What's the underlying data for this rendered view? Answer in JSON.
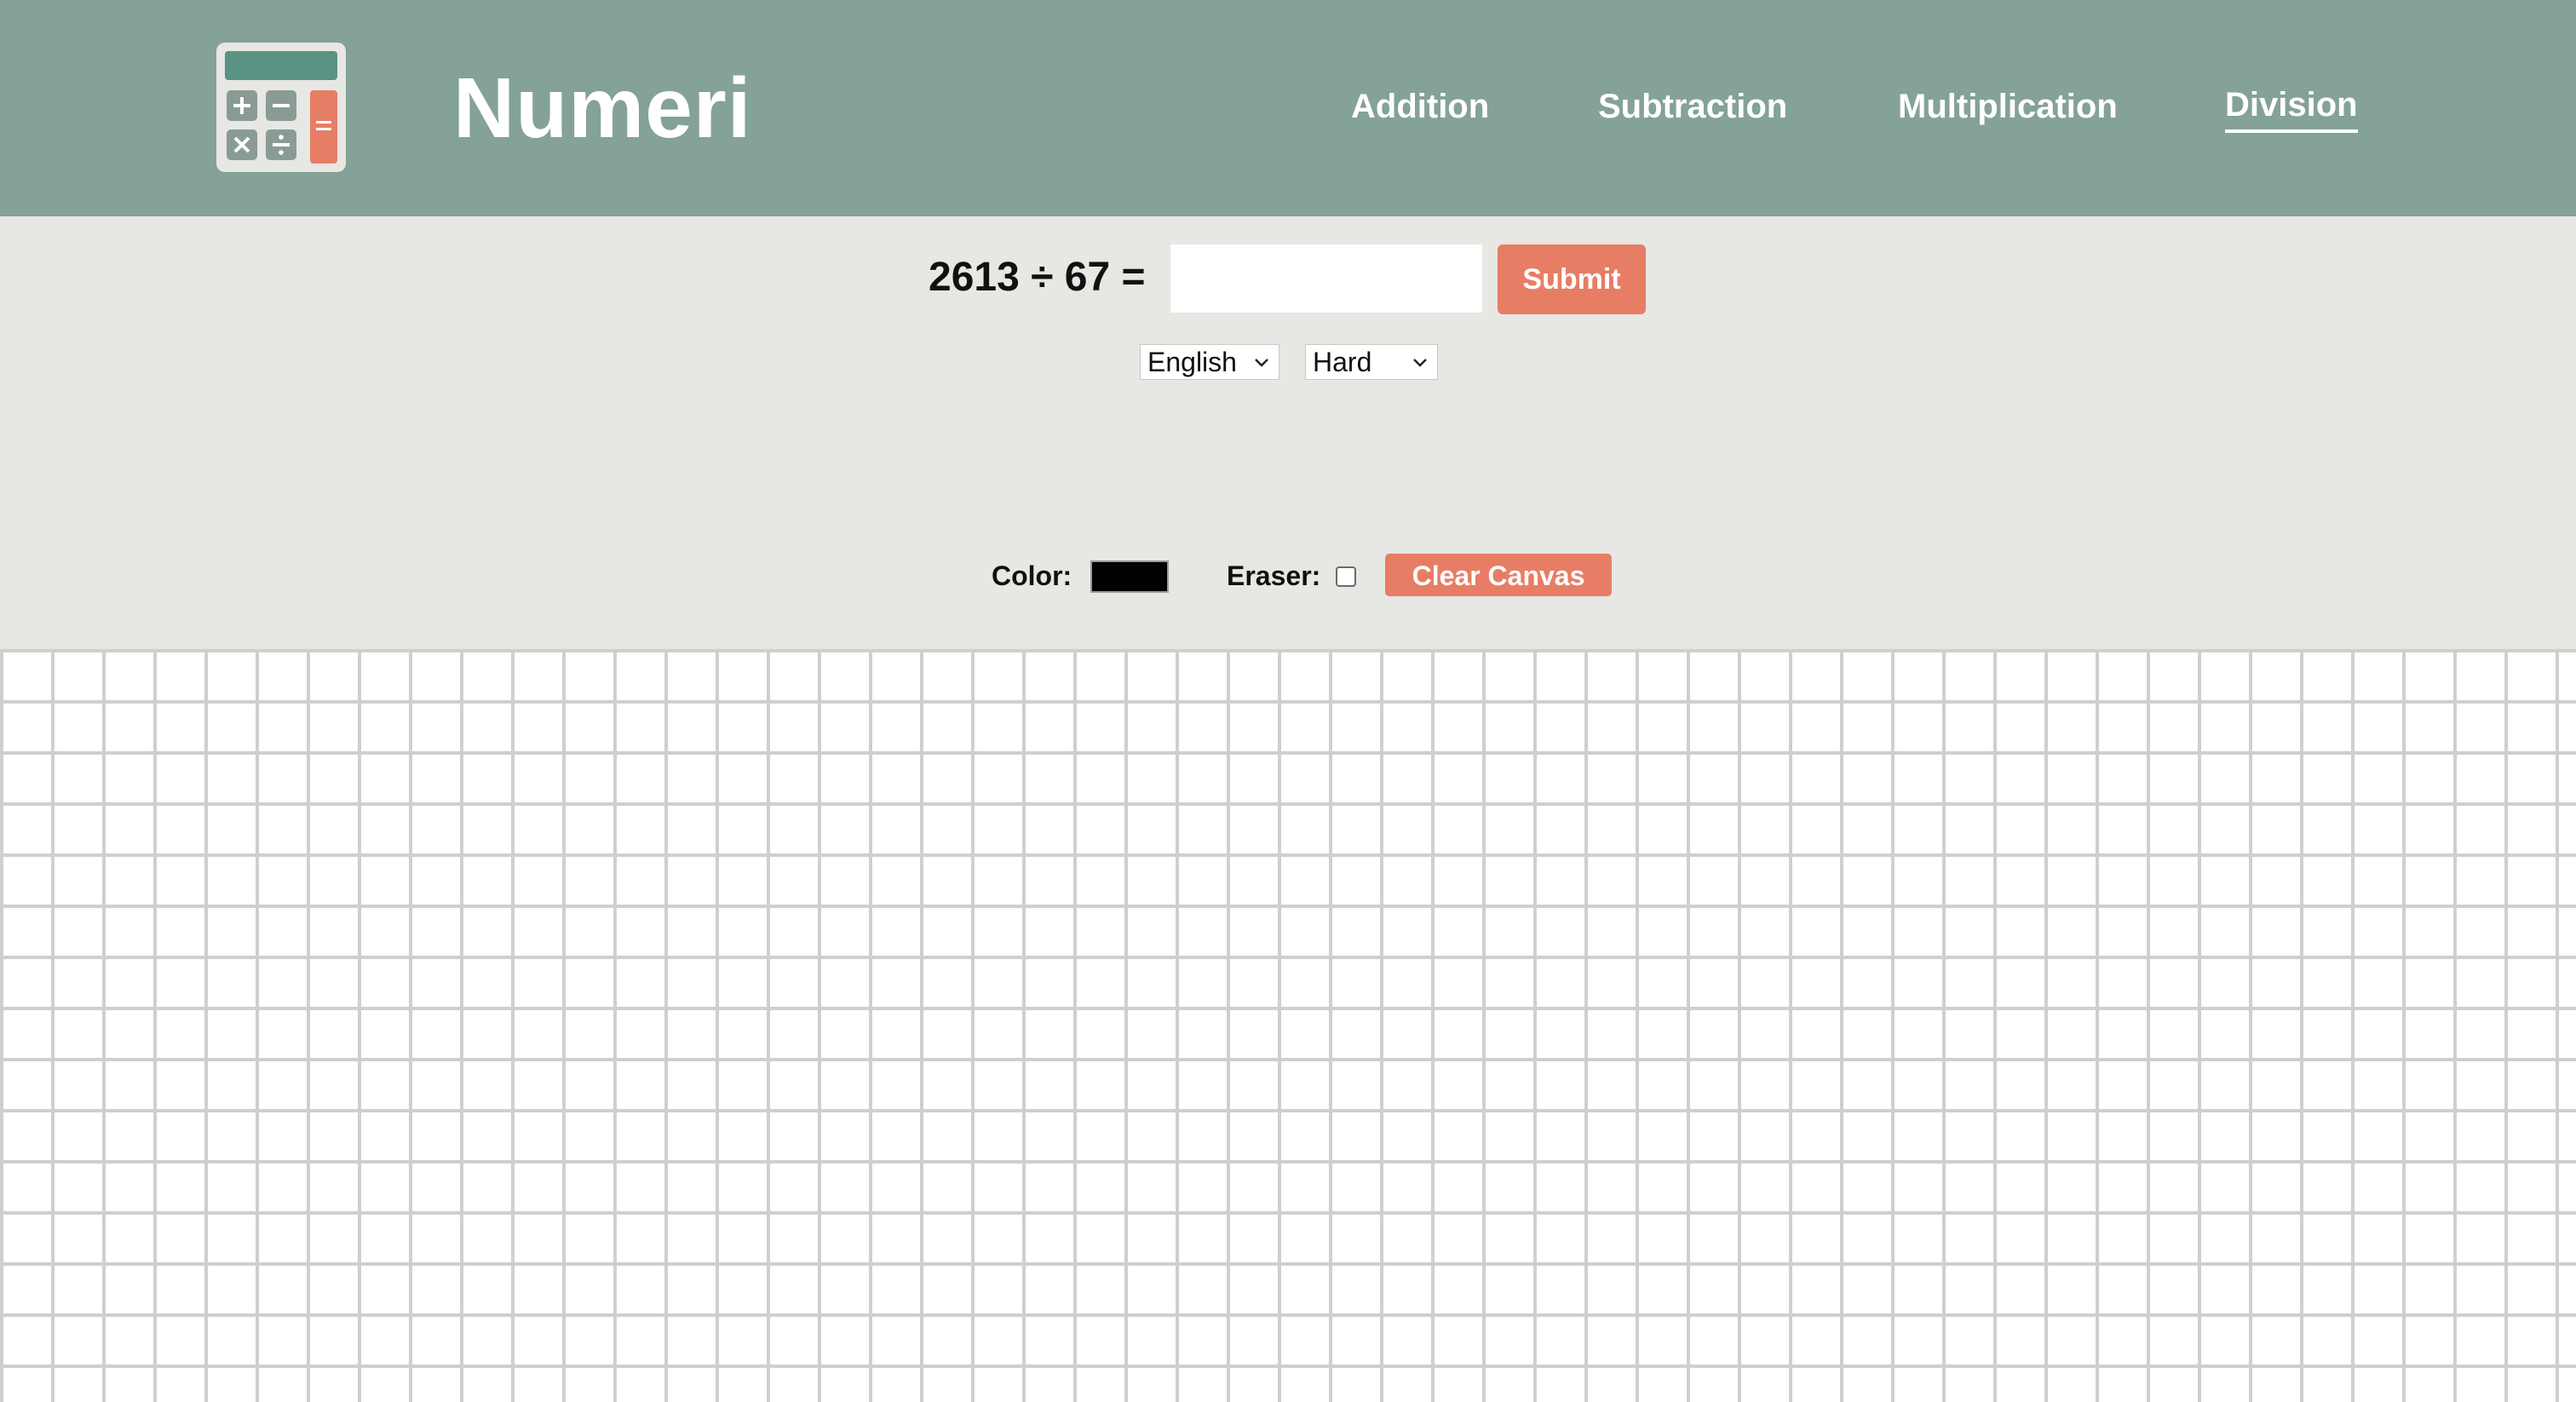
{
  "header": {
    "brand": "Numeri",
    "logo_icon": "calculator-icon",
    "nav": [
      {
        "label": "Addition",
        "active": false
      },
      {
        "label": "Subtraction",
        "active": false
      },
      {
        "label": "Multiplication",
        "active": false
      },
      {
        "label": "Division",
        "active": true
      }
    ]
  },
  "problem": {
    "expression": "2613 ÷ 67 =",
    "answer_value": "",
    "submit_label": "Submit"
  },
  "settings": {
    "language": "English",
    "difficulty": "Hard"
  },
  "tools": {
    "color_label": "Color:",
    "color_value": "#000000",
    "eraser_label": "Eraser:",
    "eraser_checked": false,
    "clear_label": "Clear Canvas"
  },
  "colors": {
    "header_bg": "#84a297",
    "page_bg": "#e7e7e3",
    "accent": "#e77d65",
    "grid_line": "#cfcfcf"
  }
}
